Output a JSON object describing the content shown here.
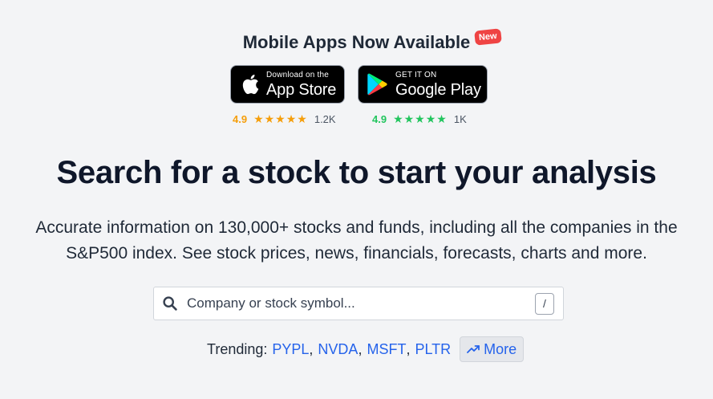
{
  "apps": {
    "title": "Mobile Apps Now Available",
    "badge": "New",
    "app_store": {
      "small": "Download on the",
      "big": "App Store",
      "rating": "4.9",
      "stars": "★★★★★",
      "count": "1.2K"
    },
    "google_play": {
      "small": "GET IT ON",
      "big": "Google Play",
      "rating": "4.9",
      "stars": "★★★★★",
      "count": "1K"
    }
  },
  "headline": "Search for a stock to start your analysis",
  "subtext": "Accurate information on 130,000+ stocks and funds, including all the companies in the S&P500 index. See stock prices, news, financials, forecasts, charts and more.",
  "search": {
    "placeholder": "Company or stock symbol...",
    "shortcut": "/"
  },
  "trending": {
    "label": "Trending:",
    "tickers": [
      "PYPL",
      "NVDA",
      "MSFT",
      "PLTR"
    ],
    "separator": ",",
    "more_label": "More"
  },
  "colors": {
    "accent": "#2563eb",
    "apple_rating": "#f59e0b",
    "google_rating": "#22c55e",
    "badge": "#ef4444"
  }
}
